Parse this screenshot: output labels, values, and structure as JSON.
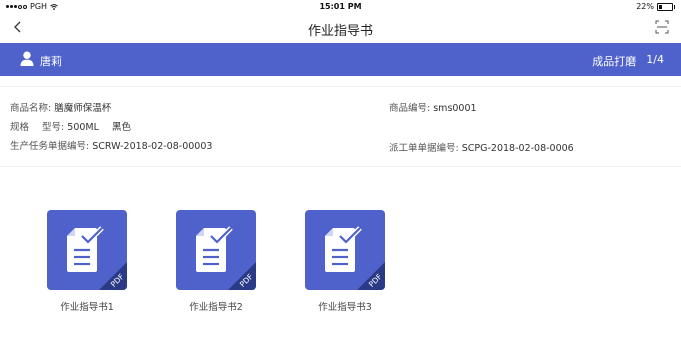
{
  "status_bar": {
    "carrier": "PGH",
    "time": "15:01 PM",
    "battery_text": "22%",
    "battery_level": 0.22
  },
  "nav": {
    "title": "作业指导书",
    "back_icon": "chevron-left-icon",
    "scan_icon": "scan-icon"
  },
  "user_bar": {
    "name": "唐莉",
    "process": "成品打磨",
    "page": "1/4",
    "background": "#4f62cc"
  },
  "info": {
    "product_name_label": "商品名称:",
    "product_name": "膳魔师保温杯",
    "product_code_label": "商品编号:",
    "product_code": "sms0001",
    "spec_label": "规格",
    "model_label": "型号:",
    "model": "500ML",
    "color": "黑色",
    "task_no_label": "生产任务单据编号:",
    "task_no": "SCRW-2018-02-08-00003",
    "dispatch_no_label": "派工单单据编号:",
    "dispatch_no": "SCPG-2018-02-08-0006"
  },
  "documents": [
    {
      "label": "作业指导书1",
      "badge": "PDF",
      "icon": "pdf-document-icon"
    },
    {
      "label": "作业指导书2",
      "badge": "PDF",
      "icon": "pdf-document-icon"
    },
    {
      "label": "作业指导书3",
      "badge": "PDF",
      "icon": "pdf-document-icon"
    }
  ]
}
